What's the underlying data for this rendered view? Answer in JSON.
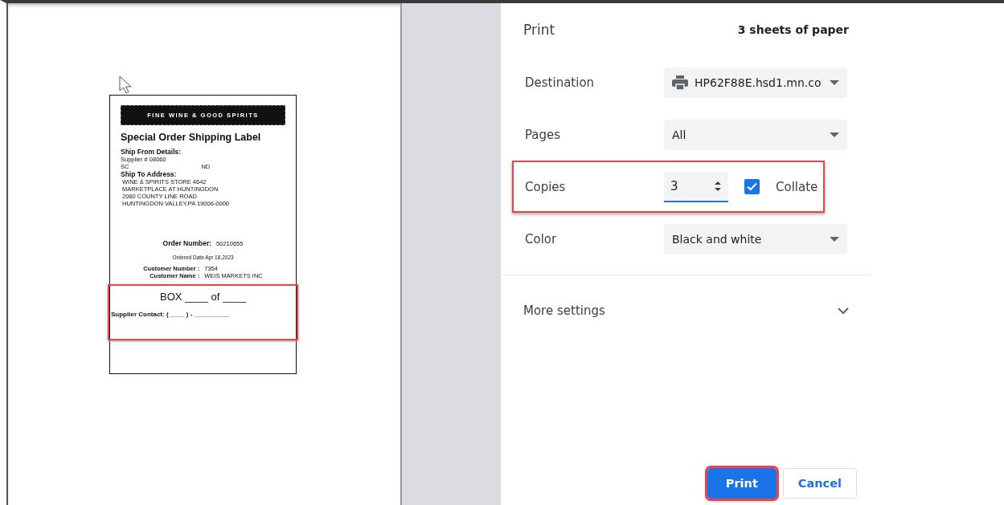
{
  "preview": {
    "label": {
      "logo": "FINE WINE & GOOD SPIRITS",
      "title": "Special Order Shipping Label",
      "ship_from_heading": "Ship From Details:",
      "supplier_number": "Supplier # 08060",
      "ship_from_line": [
        "SC",
        "ND"
      ],
      "ship_to_heading": "Ship To Address:",
      "ship_to_lines": [
        "WINE & SPIRITS STORE 4642",
        "MARKETPLACE AT HUNTINGDON",
        "2080 COUNTY LINE ROAD",
        "HUNTINGDON VALLEY,PA 19006-0000"
      ],
      "order_number_label": "Order Number:",
      "order_number": "50210655",
      "ordered_date": "Ordered Date Apr 18,2023",
      "customer_number_label": "Customer Number :",
      "customer_number": "7354",
      "customer_name_label": "Customer Name :",
      "customer_name": "WEIS MARKETS INC",
      "box_line": "BOX ____ of ____",
      "supplier_contact": "Supplier Contact: ( ____ ) -  __________",
      "highlighted": true
    }
  },
  "settings": {
    "title": "Print",
    "sheets_summary": "3 sheets of paper",
    "rows": [
      {
        "kind": "printer-select",
        "label": "Destination",
        "value": "HP62F88E.hsd1.mn.co"
      },
      {
        "kind": "select",
        "label": "Pages",
        "value": "All"
      },
      {
        "kind": "copies",
        "label": "Copies",
        "value": "3",
        "collate": {
          "label": "Collate",
          "checked": true
        },
        "highlighted": true
      },
      {
        "kind": "select",
        "label": "Color",
        "value": "Black and white"
      }
    ],
    "more_settings": {
      "label": "More settings",
      "expanded": false
    },
    "buttons": [
      {
        "label": "Print",
        "primary": true,
        "highlighted": true
      },
      {
        "label": "Cancel",
        "primary": false,
        "highlighted": false
      }
    ]
  }
}
